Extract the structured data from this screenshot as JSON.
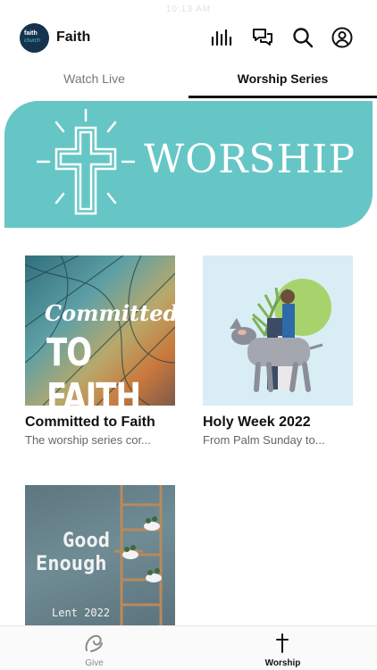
{
  "status_time": "10:13 AM",
  "app": {
    "brand": "Faith",
    "logo_line1": "faith",
    "logo_line2": "church"
  },
  "header_icons": [
    "bar-chart-icon",
    "chat-icon",
    "search-icon",
    "profile-icon"
  ],
  "tabs": [
    {
      "label": "Watch Live",
      "selected": false
    },
    {
      "label": "Worship Series",
      "selected": true
    }
  ],
  "banner": {
    "title": "WORSHIP",
    "color": "#66c6c6"
  },
  "series": [
    {
      "title": "Committed to Faith",
      "subtitle": "The worship series cor...",
      "image_text_1": "Committed",
      "image_text_2": "TO FAITH"
    },
    {
      "title": "Holy Week 2022",
      "subtitle": "From Palm Sunday to..."
    },
    {
      "image_text_1": "Good",
      "image_text_2": "Enough",
      "image_text_3": "Lent 2022"
    }
  ],
  "nav": {
    "items": [
      {
        "label": "Give",
        "icon": "give-icon",
        "active": false
      },
      {
        "label": "Worship",
        "icon": "cross-icon",
        "active": true
      }
    ]
  }
}
